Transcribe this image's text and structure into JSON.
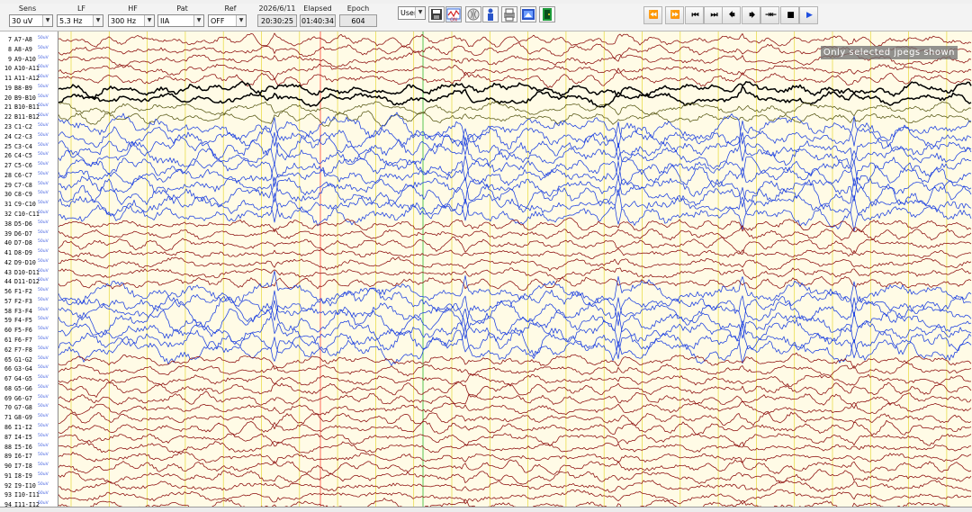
{
  "toolbar": {
    "sens": {
      "label": "Sens",
      "value": "30 uV"
    },
    "lf": {
      "label": "LF",
      "value": "5.3 Hz"
    },
    "hf": {
      "label": "HF",
      "value": "300 Hz"
    },
    "pat": {
      "label": "Pat",
      "value": "IIA"
    },
    "ref": {
      "label": "Ref",
      "value": "OFF"
    },
    "date": {
      "label": "2026/6/11",
      "value": "20:30:25"
    },
    "elapsed": {
      "label": "Elapsed",
      "value": "01:40:34"
    },
    "epoch": {
      "label": "Epoch",
      "value": "604"
    },
    "user_select": "User",
    "tools": [
      "save-icon",
      "montage-icon",
      "brain-icon",
      "person-icon",
      "print-icon",
      "export-icon",
      "exit-icon"
    ],
    "playback": [
      "⏪",
      "⏩",
      "⏮",
      "⏭",
      "⏴⏸",
      "⏸⏵",
      "⇥⇤",
      "■",
      "▶"
    ]
  },
  "watermark": "Only selected jpegs shown",
  "channels": [
    {
      "n": "7",
      "name": "A7-A8"
    },
    {
      "n": "8",
      "name": "A8-A9"
    },
    {
      "n": "9",
      "name": "A9-A10"
    },
    {
      "n": "10",
      "name": "A10-A11"
    },
    {
      "n": "11",
      "name": "A11-A12"
    },
    {
      "n": "19",
      "name": "B8-B9"
    },
    {
      "n": "20",
      "name": "B9-B10"
    },
    {
      "n": "21",
      "name": "B10-B11"
    },
    {
      "n": "22",
      "name": "B11-B12"
    },
    {
      "n": "23",
      "name": "C1-C2"
    },
    {
      "n": "24",
      "name": "C2-C3"
    },
    {
      "n": "25",
      "name": "C3-C4"
    },
    {
      "n": "26",
      "name": "C4-C5"
    },
    {
      "n": "27",
      "name": "C5-C6"
    },
    {
      "n": "28",
      "name": "C6-C7"
    },
    {
      "n": "29",
      "name": "C7-C8"
    },
    {
      "n": "30",
      "name": "C8-C9"
    },
    {
      "n": "31",
      "name": "C9-C10"
    },
    {
      "n": "32",
      "name": "C10-C11"
    },
    {
      "n": "38",
      "name": "D5-D6"
    },
    {
      "n": "39",
      "name": "D6-D7"
    },
    {
      "n": "40",
      "name": "D7-D8"
    },
    {
      "n": "41",
      "name": "D8-D9"
    },
    {
      "n": "42",
      "name": "D9-D10"
    },
    {
      "n": "43",
      "name": "D10-D11"
    },
    {
      "n": "44",
      "name": "D11-D12"
    },
    {
      "n": "56",
      "name": "F1-F2"
    },
    {
      "n": "57",
      "name": "F2-F3"
    },
    {
      "n": "58",
      "name": "F3-F4"
    },
    {
      "n": "59",
      "name": "F4-F5"
    },
    {
      "n": "60",
      "name": "F5-F6"
    },
    {
      "n": "61",
      "name": "F6-F7"
    },
    {
      "n": "62",
      "name": "F7-F8"
    },
    {
      "n": "65",
      "name": "G1-G2"
    },
    {
      "n": "66",
      "name": "G3-G4"
    },
    {
      "n": "67",
      "name": "G4-G5"
    },
    {
      "n": "68",
      "name": "G5-G6"
    },
    {
      "n": "69",
      "name": "G6-G7"
    },
    {
      "n": "70",
      "name": "G7-G8"
    },
    {
      "n": "71",
      "name": "G8-G9"
    },
    {
      "n": "86",
      "name": "I1-I2"
    },
    {
      "n": "87",
      "name": "I4-I5"
    },
    {
      "n": "88",
      "name": "I5-I6"
    },
    {
      "n": "89",
      "name": "I6-I7"
    },
    {
      "n": "90",
      "name": "I7-I8"
    },
    {
      "n": "91",
      "name": "I8-I9"
    },
    {
      "n": "92",
      "name": "I9-I10"
    },
    {
      "n": "93",
      "name": "I10-I11"
    },
    {
      "n": "94",
      "name": "I11-I12"
    }
  ],
  "unit_label": "50uV",
  "colors": {
    "background": "#fffbe6",
    "group_red": "#8b0a0a",
    "group_blue": "#1a3ee0",
    "group_black": "#000000",
    "group_olive": "#555512",
    "marker_yellow": "#e2d31c",
    "marker_red": "#ff3a2c",
    "marker_green": "#26b426"
  },
  "groups": [
    {
      "start": 0,
      "end": 4,
      "color": "#8b0a0a"
    },
    {
      "start": 5,
      "end": 6,
      "color": "#000000"
    },
    {
      "start": 7,
      "end": 8,
      "color": "#555512"
    },
    {
      "start": 9,
      "end": 18,
      "color": "#1a3ee0"
    },
    {
      "start": 19,
      "end": 25,
      "color": "#8b0a0a"
    },
    {
      "start": 26,
      "end": 32,
      "color": "#1a3ee0"
    },
    {
      "start": 33,
      "end": 48,
      "color": "#8b0a0a"
    }
  ]
}
